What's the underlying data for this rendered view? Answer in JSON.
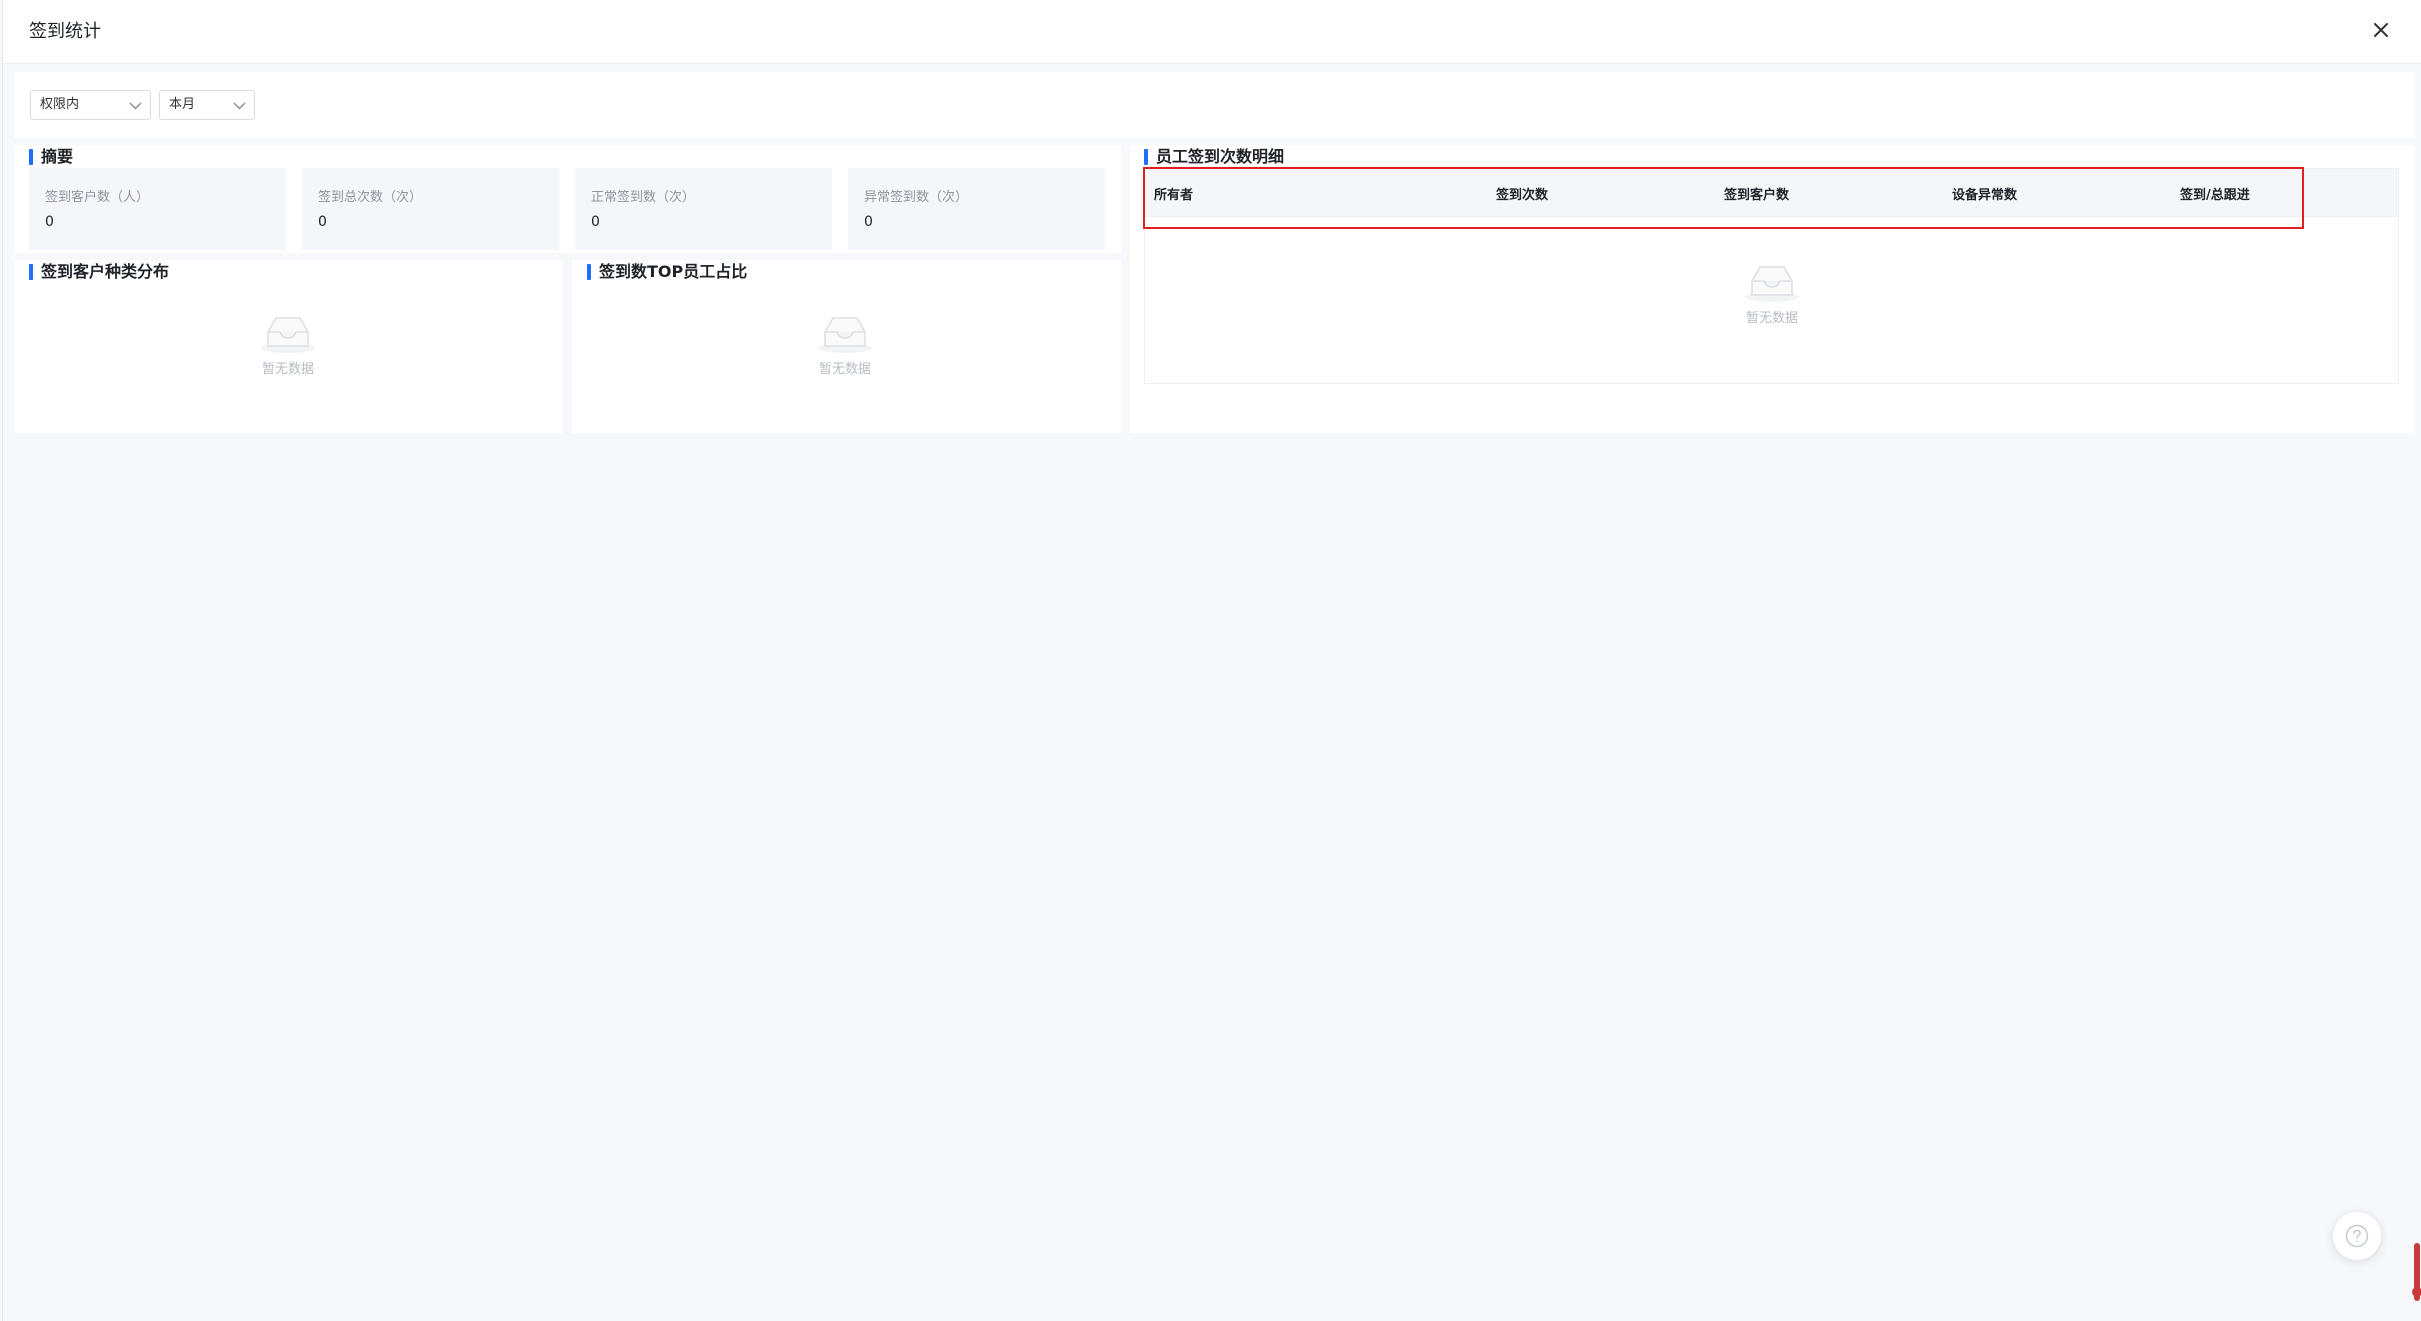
{
  "dialog": {
    "title": "签到统计"
  },
  "filters": {
    "scope": "权限内",
    "period": "本月"
  },
  "summary": {
    "title": "摘要",
    "stats": [
      {
        "label": "签到客户数（人）",
        "value": "0"
      },
      {
        "label": "签到总次数（次）",
        "value": "0"
      },
      {
        "label": "正常签到数（次）",
        "value": "0"
      },
      {
        "label": "异常签到数（次）",
        "value": "0"
      }
    ]
  },
  "customer_distribution": {
    "title": "签到客户种类分布",
    "empty_text": "暂无数据"
  },
  "top_staff": {
    "title": "签到数TOP员工占比",
    "empty_text": "暂无数据"
  },
  "detail": {
    "title": "员工签到次数明细",
    "columns": [
      "所有者",
      "签到次数",
      "签到客户数",
      "设备异常数",
      "签到/总跟进"
    ],
    "empty_text": "暂无数据"
  },
  "icons": {
    "close": "close-icon",
    "dropdown": "chevron-down-icon",
    "empty": "empty-box-icon",
    "help": "help-icon"
  },
  "colors": {
    "accent": "#1f6fff",
    "highlight": "#e02020"
  }
}
